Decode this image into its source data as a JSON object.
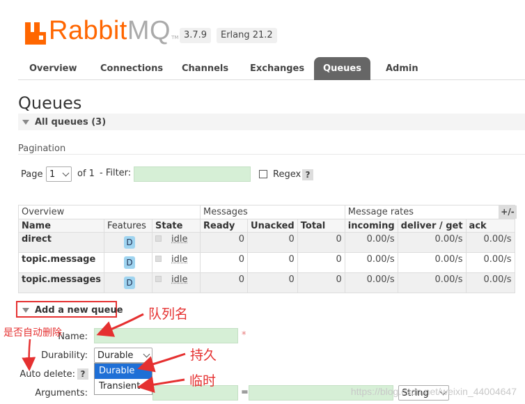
{
  "app": {
    "logo_main": "Rabbit",
    "logo_accent": "MQ",
    "logo_tm": "TM",
    "version": "3.7.9",
    "erlang": "Erlang 21.2"
  },
  "tabs": [
    {
      "label": "Overview"
    },
    {
      "label": "Connections"
    },
    {
      "label": "Channels"
    },
    {
      "label": "Exchanges"
    },
    {
      "label": "Queues"
    },
    {
      "label": "Admin"
    }
  ],
  "page_title": "Queues",
  "all_queues": "All queues (3)",
  "pagination": {
    "label": "Pagination",
    "page_label": "Page",
    "page_value": "1",
    "of_label": "of 1",
    "filter_label": "- Filter:",
    "filter_value": "",
    "regex_label": "Regex",
    "help": "?"
  },
  "table": {
    "groups": [
      "Overview",
      "Messages",
      "Message rates"
    ],
    "columns": [
      "Name",
      "Features",
      "State",
      "Ready",
      "Unacked",
      "Total",
      "incoming",
      "deliver / get",
      "ack"
    ],
    "rows": [
      {
        "name": "direct",
        "feature": "D",
        "state": "idle",
        "ready": "0",
        "unacked": "0",
        "total": "0",
        "incoming": "0.00/s",
        "deliver": "0.00/s",
        "ack": "0.00/s"
      },
      {
        "name": "topic.message",
        "feature": "D",
        "state": "idle",
        "ready": "0",
        "unacked": "0",
        "total": "0",
        "incoming": "0.00/s",
        "deliver": "0.00/s",
        "ack": "0.00/s"
      },
      {
        "name": "topic.messages",
        "feature": "D",
        "state": "idle",
        "ready": "0",
        "unacked": "0",
        "total": "0",
        "incoming": "0.00/s",
        "deliver": "0.00/s",
        "ack": "0.00/s"
      }
    ],
    "toggle": "+/-"
  },
  "add_queue": {
    "title": "Add a new queue",
    "name_label": "Name:",
    "name_value": "",
    "required_mark": "*",
    "durability_label": "Durability:",
    "durability_value": "Durable",
    "durability_options": [
      "Durable",
      "Transient"
    ],
    "auto_delete_label": "Auto delete:",
    "help": "?",
    "arguments_label": "Arguments:",
    "arg_equals": "=",
    "arg_type": "String"
  },
  "annotations": {
    "queue_name": "队列名",
    "auto_delete": "是否自动删除",
    "durable": "持久",
    "transient": "临时"
  },
  "watermark": "https://blog.csdn.net/weixin_44004647",
  "colors": {
    "brand": "#ff6600",
    "active_tab": "#666666",
    "annotation": "#e53030",
    "input_bg": "#d6efd6",
    "selected_option": "#1e6fd6",
    "feature_badge": "#9fd4f0"
  }
}
